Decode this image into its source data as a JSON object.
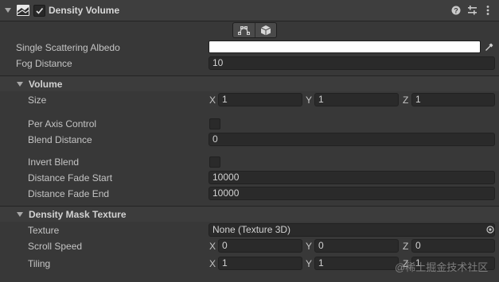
{
  "header": {
    "title": "Density Volume",
    "enabled": true
  },
  "fields": {
    "single_scattering_albedo": {
      "label": "Single Scattering Albedo",
      "color": "#FFFFFF"
    },
    "fog_distance": {
      "label": "Fog Distance",
      "value": "10"
    }
  },
  "volume": {
    "title": "Volume",
    "size": {
      "label": "Size",
      "x_label": "X",
      "x": "1",
      "y_label": "Y",
      "y": "1",
      "z_label": "Z",
      "z": "1"
    },
    "per_axis_control": {
      "label": "Per Axis Control",
      "checked": false
    },
    "blend_distance": {
      "label": "Blend Distance",
      "value": "0"
    },
    "invert_blend": {
      "label": "Invert Blend",
      "checked": false
    },
    "distance_fade_start": {
      "label": "Distance Fade Start",
      "value": "10000"
    },
    "distance_fade_end": {
      "label": "Distance Fade End",
      "value": "10000"
    }
  },
  "density_mask": {
    "title": "Density Mask Texture",
    "texture": {
      "label": "Texture",
      "value": "None (Texture 3D)"
    },
    "scroll_speed": {
      "label": "Scroll Speed",
      "x_label": "X",
      "x": "0",
      "y_label": "Y",
      "y": "0",
      "z_label": "Z",
      "z": "0"
    },
    "tiling": {
      "label": "Tiling",
      "x_label": "X",
      "x": "1",
      "y_label": "Y",
      "y": "1",
      "z_label": "Z",
      "z": "1"
    }
  },
  "watermark": "@稀土掘金技术社区",
  "icons": {
    "header": [
      "fold-arrow-icon",
      "density-volume-icon",
      "checkmark-icon",
      "help-icon",
      "preset-icon",
      "kebab-menu-icon"
    ],
    "toolbar": [
      "edit-bounds-icon",
      "box-gizmo-icon"
    ],
    "fields": [
      "eyedropper-icon",
      "object-picker-icon"
    ]
  },
  "colors": {
    "background": "#383838",
    "field": "#2A2A2A",
    "text": "#C4C4C4"
  }
}
